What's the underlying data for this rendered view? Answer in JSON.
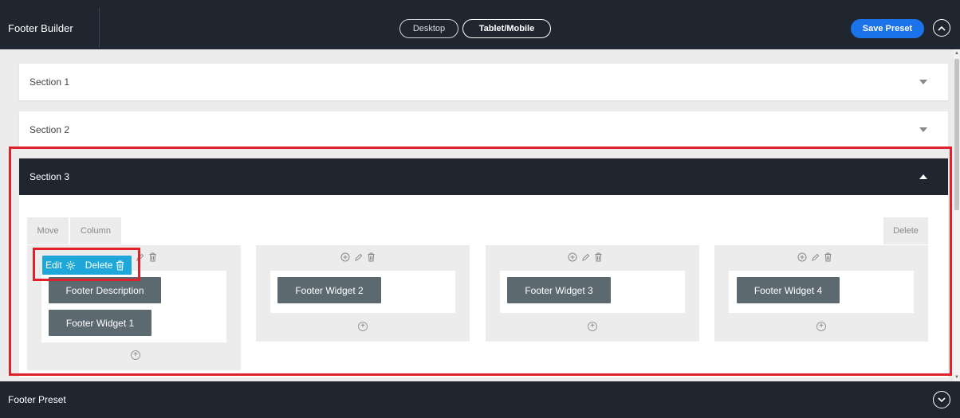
{
  "header": {
    "title": "Footer Builder",
    "desktop_label": "Desktop",
    "mobile_label": "Tablet/Mobile",
    "save_label": "Save Preset",
    "save_color": "#1a73e8"
  },
  "sections": [
    {
      "label": "Section 1",
      "state": "collapsed"
    },
    {
      "label": "Section 2",
      "state": "collapsed"
    },
    {
      "label": "Section 3",
      "state": "expanded"
    }
  ],
  "section3": {
    "tabs": {
      "move": "Move",
      "column": "Column",
      "delete": "Delete"
    },
    "popup": {
      "edit": "Edit",
      "delete": "Delete"
    },
    "columns": [
      {
        "widgets": [
          "Footer Description",
          "Footer Widget 1"
        ]
      },
      {
        "widgets": [
          "Footer Widget 2"
        ]
      },
      {
        "widgets": [
          "Footer Widget 3"
        ]
      },
      {
        "widgets": [
          "Footer Widget 4"
        ]
      }
    ]
  },
  "footer_bar": {
    "label": "Footer Preset"
  },
  "colors": {
    "dark": "#1f2630",
    "widget": "#5d6971",
    "popup": "#1ea7d8",
    "highlight": "#e0202a"
  }
}
